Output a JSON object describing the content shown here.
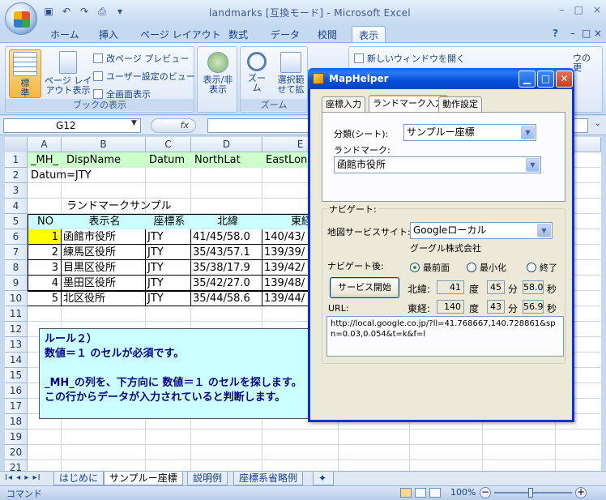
{
  "window": {
    "title": "landmarks [互換モード] - Microsoft Excel",
    "controls": [
      "–",
      "□",
      "×"
    ]
  },
  "ribbon": {
    "tabs": [
      "ホーム",
      "挿入",
      "ページ レイアウト",
      "数式",
      "データ",
      "校閲",
      "表示"
    ],
    "active_tab": "表示",
    "help_controls": [
      "?",
      "–",
      "□",
      "×"
    ],
    "book_view": {
      "group_label": "ブックの表示",
      "normal": "標\n準",
      "page_layout": "ページ レイ\nアウト表示",
      "page_break": "改ページ プレビュー",
      "custom_view": "ユーザー設定のビュー",
      "full_screen": "全画面表示"
    },
    "show_hide": "表示/非\n表示",
    "zoom": {
      "group_label": "ズーム",
      "zoom_btn": "ズー\nム",
      "zoom_selection": "選択範\nせて拡"
    },
    "window_group": {
      "new_window": "新しいウィンドウを開く",
      "right_label": "ウの\n更"
    }
  },
  "formula_bar": {
    "name_box": "G12",
    "fx": "fx",
    "value": ""
  },
  "sheet": {
    "columns": [
      "A",
      "B",
      "C",
      "D",
      "E"
    ],
    "selected_column": "G",
    "rows": [
      "1",
      "2",
      "3",
      "4",
      "5",
      "6",
      "7",
      "8",
      "9",
      "10",
      "11",
      "12",
      "13",
      "14",
      "15",
      "16",
      "17",
      "18",
      "19",
      "20",
      "21",
      "22"
    ],
    "row1": [
      "_MH_",
      "DispName",
      "Datum",
      "NorthLat",
      "EastLon"
    ],
    "row2": "Datum=JTY",
    "row4": "ランドマークサンプル",
    "header": [
      "NO",
      "表示名",
      "座標系",
      "北緯",
      "東経"
    ],
    "data": [
      [
        "1",
        "函館市役所",
        "JTY",
        "41/45/58.0",
        "140/43/"
      ],
      [
        "2",
        "練馬区役所",
        "JTY",
        "35/43/57.1",
        "139/39/"
      ],
      [
        "3",
        "目黒区役所",
        "JTY",
        "35/38/17.9",
        "139/42/"
      ],
      [
        "4",
        "墨田区役所",
        "JTY",
        "35/42/27.0",
        "139/48/"
      ],
      [
        "5",
        "北区役所",
        "JTY",
        "35/44/58.6",
        "139/44/"
      ]
    ],
    "comment_lines": [
      "ルール２）",
      "数値＝１ のセルが必須です。",
      "",
      "_MH_の列を、下方向に 数値＝１ のセルを探します。",
      "この行からデータが入力されていると判断します。"
    ],
    "sheet_tabs": [
      "はじめに",
      "サンプルー座標",
      "説明例",
      "座標系省略例"
    ],
    "active_sheet": "サンプルー座標",
    "nav_arrows": "I◂ ◂ ▸ ▸I"
  },
  "status": {
    "mode": "コマンド",
    "zoom": "100%"
  },
  "maphelper": {
    "title": "MapHelper",
    "tabs": [
      "座標入力",
      "ランドマーク入力",
      "動作設定"
    ],
    "active_tab": "ランドマーク入力",
    "category_label": "分類(シート):",
    "category_value": "サンプルー座標",
    "landmark_label": "ランドマーク:",
    "landmark_value": "函館市役所",
    "nav_group_label": "ナビゲート:",
    "site_label": "地図サービスサイト:",
    "site_value": "Googleローカル",
    "company": "グーグル株式会社",
    "after_nav_label": "ナビゲート後:",
    "after_nav_options": [
      "最前面",
      "最小化",
      "終了"
    ],
    "after_nav_selected": "最前面",
    "start_button": "サービス開始",
    "north_label": "北緯:",
    "north": {
      "deg": "41",
      "min": "45",
      "sec": "58.0"
    },
    "east_label": "東経:",
    "east": {
      "deg": "140",
      "min": "43",
      "sec": "56.9"
    },
    "deg_unit": "度",
    "min_unit": "分",
    "sec_unit": "秒",
    "url_label": "URL:",
    "url": "http://local.google.co.jp/?ll=41.768667,140.728861&spn=0.03,0.054&t=k&f=l"
  }
}
